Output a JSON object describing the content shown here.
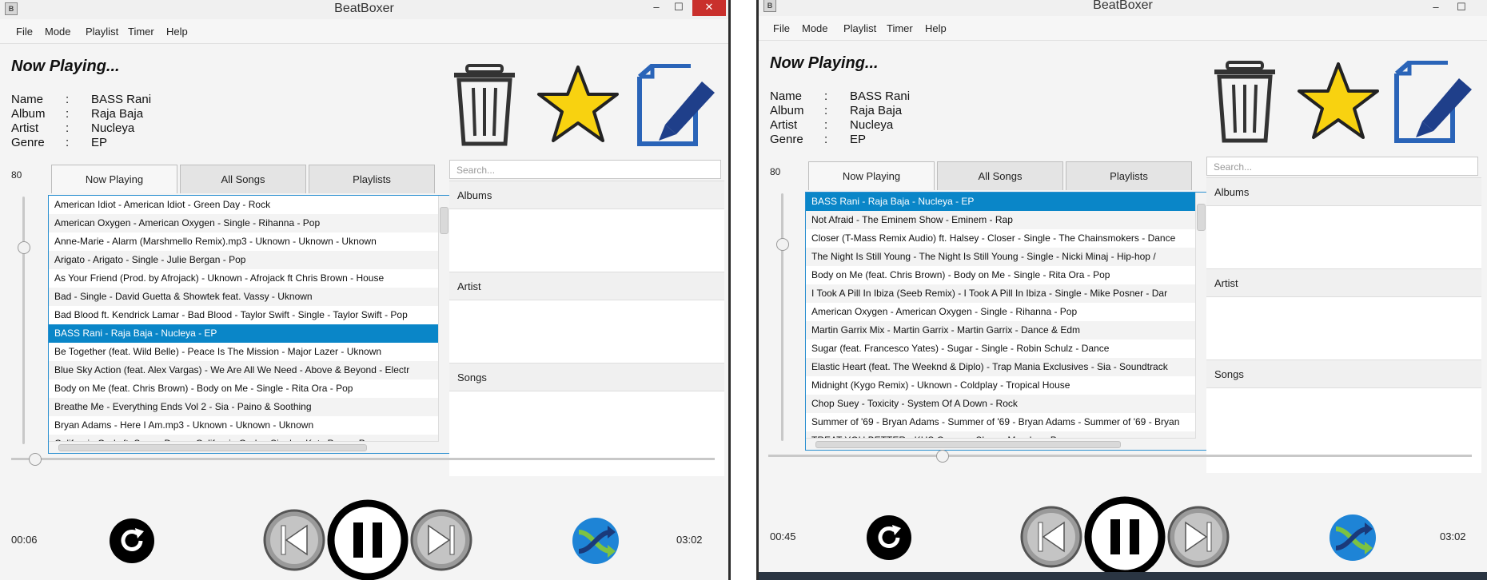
{
  "colors": {
    "accent": "#0a86c8",
    "selection_text": "#ffffff",
    "close_button": "#c9302c",
    "star": "#f8d210",
    "edit_icon": "#2a64b8"
  },
  "windows": [
    {
      "title": "BeatBoxer",
      "menu": [
        "File",
        "Mode",
        "Playlist",
        "Timer",
        "Help"
      ],
      "now_playing_label": "Now Playing...",
      "info": [
        {
          "key": "Name",
          "value": "BASS Rani"
        },
        {
          "key": "Album",
          "value": "Raja Baja"
        },
        {
          "key": "Artist",
          "value": "Nucleya"
        },
        {
          "key": "Genre",
          "value": "EP"
        }
      ],
      "volume": "80",
      "tabs": [
        "Now Playing",
        "All Songs",
        "Playlists"
      ],
      "songs": [
        "American Idiot   -   American Idiot   -   Green Day   -   Rock",
        "American Oxygen   -   American Oxygen - Single   -   Rihanna   -   Pop",
        "Anne-Marie - Alarm (Marshmello Remix).mp3   -   Uknown   -   Uknown   -   Uknown",
        "Arigato   -   Arigato - Single   -   Julie Bergan   -   Pop",
        "As Your Friend (Prod. by Afrojack)   -   Uknown   -   Afrojack ft Chris Brown   -   House",
        "Bad   -   Single   -   David Guetta & Showtek feat. Vassy   -   Uknown",
        "Bad Blood ft. Kendrick Lamar   -   Bad Blood - Taylor Swift - Single   -   Taylor Swift   -   Pop",
        "BASS Rani   -   Raja Baja   -   Nucleya   -   EP",
        "Be Together (feat. Wild Belle)   -   Peace Is The Mission   -   Major Lazer   -   Uknown",
        "Blue Sky Action (feat. Alex Vargas)   -   We Are All We Need   -   Above & Beyond   -   Electr",
        "Body on Me (feat. Chris Brown)   -   Body on Me - Single   -   Rita Ora   -   Pop",
        "Breathe Me   -   Everything Ends Vol 2   -   Sia   -   Paino & Soothing",
        "Bryan Adams - Here I Am.mp3   -   Uknown   -   Uknown   -   Uknown",
        "California Gurls ft. Snoop Dogg   -   California Gurls - Single   -   Katy Perry   -   Pop"
      ],
      "selected_index": 7,
      "search_placeholder": "Search...",
      "sections": [
        "Albums",
        "Artist",
        "Songs"
      ],
      "elapsed": "00:06",
      "duration": "03:02",
      "seek_fraction": 0.033
    },
    {
      "title": "BeatBoxer",
      "menu": [
        "File",
        "Mode",
        "Playlist",
        "Timer",
        "Help"
      ],
      "now_playing_label": "Now Playing...",
      "info": [
        {
          "key": "Name",
          "value": "BASS Rani"
        },
        {
          "key": "Album",
          "value": "Raja Baja"
        },
        {
          "key": "Artist",
          "value": "Nucleya"
        },
        {
          "key": "Genre",
          "value": "EP"
        }
      ],
      "volume": "80",
      "tabs": [
        "Now Playing",
        "All Songs",
        "Playlists"
      ],
      "songs": [
        "BASS Rani   -   Raja Baja   -   Nucleya   -   EP",
        "Not Afraid   -   The Eminem Show   -   Eminem   -   Rap",
        "Closer (T-Mass Remix Audio) ft. Halsey   -   Closer - Single   -   The Chainsmokers   -   Dance",
        "The Night Is Still Young   -   The Night Is Still Young - Single   -   Nicki Minaj   -   Hip-hop /",
        "Body on Me (feat. Chris Brown)   -   Body on Me - Single   -   Rita Ora   -   Pop",
        "I Took A Pill In Ibiza (Seeb Remix)   -   I Took A Pill In Ibiza - Single   -   Mike Posner   -   Dar",
        "American Oxygen   -   American Oxygen - Single   -   Rihanna   -   Pop",
        "Martin Garrix Mix   -   Martin Garrix   -   Martin Garrix   -   Dance & Edm",
        "Sugar (feat. Francesco Yates)   -   Sugar - Single   -   Robin Schulz   -   Dance",
        "Elastic Heart (feat. The Weeknd & Diplo)   -   Trap Mania Exclusives   -   Sia   -   Soundtrack",
        "Midnight (Kygo Remix)   -   Uknown   -   Coldplay   -   Tropical House",
        "Chop Suey   -   Toxicity   -   System Of A Down   -   Rock",
        "Summer of '69 - Bryan Adams   -   Summer of '69 - Bryan Adams   -   Summer of '69 - Bryan",
        "TREAT YOU BETTER   -   KHS Covers   -   Shawn Mendes   -   Pop"
      ],
      "selected_index": 0,
      "search_placeholder": "Search...",
      "sections": [
        "Albums",
        "Artist",
        "Songs"
      ],
      "elapsed": "00:45",
      "duration": "03:02",
      "seek_fraction": 0.247
    }
  ]
}
